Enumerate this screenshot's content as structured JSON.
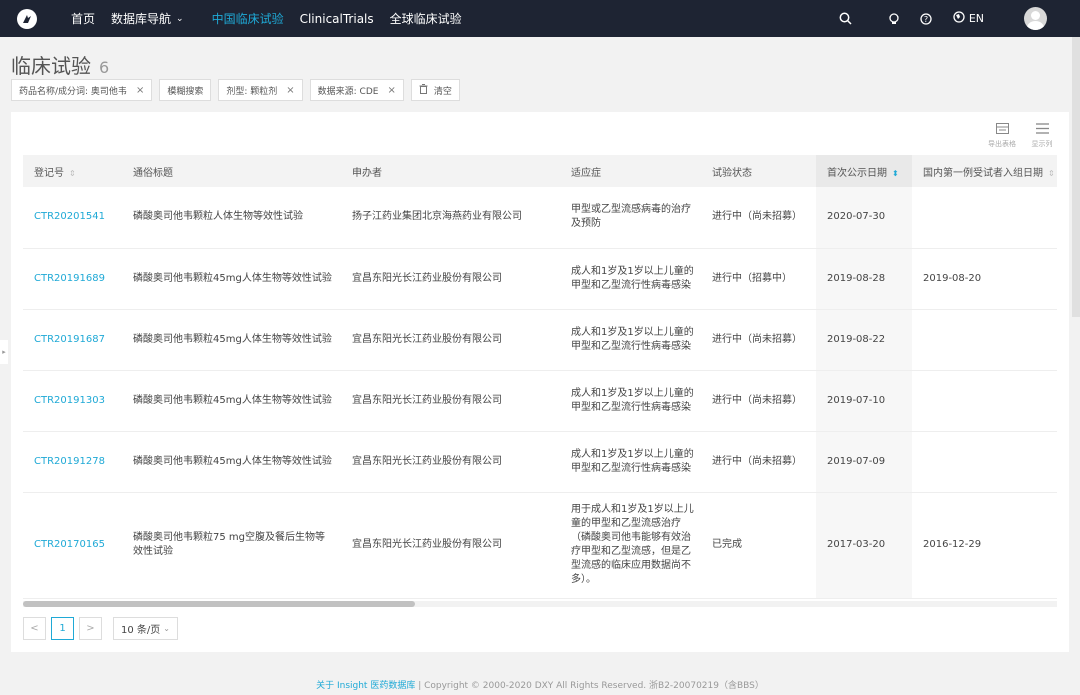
{
  "nav": {
    "home": "首页",
    "db_nav": "数据库导航",
    "china_trials": "中国临床试验",
    "clinicaltrials": "ClinicalTrials",
    "global_trials": "全球临床试验",
    "lang": "EN"
  },
  "page": {
    "title": "临床试验",
    "count": "6"
  },
  "filters": [
    {
      "label": "药品名称/成分词: 奥司他韦",
      "removable": true
    },
    {
      "label": "模糊搜索",
      "removable": false
    },
    {
      "label": "剂型: 颗粒剂",
      "removable": true
    },
    {
      "label": "数据来源: CDE",
      "removable": true
    }
  ],
  "clear_label": "清空",
  "tools": {
    "export": "导出表格",
    "columns": "显示列"
  },
  "table": {
    "headers": [
      "登记号",
      "通俗标题",
      "申办者",
      "适应症",
      "试验状态",
      "首次公示日期",
      "国内第一例受试者入组日期"
    ],
    "rows": [
      {
        "id": "CTR20201541",
        "title": "磷酸奥司他韦颗粒人体生物等效性试验",
        "sponsor": "扬子江药业集团北京海燕药业有限公司",
        "indication": "甲型或乙型流感病毒的治疗及预防",
        "status": "进行中（尚未招募）",
        "pub_date": "2020-07-30",
        "first_date": ""
      },
      {
        "id": "CTR20191689",
        "title": "磷酸奥司他韦颗粒45mg人体生物等效性试验",
        "sponsor": "宜昌东阳光长江药业股份有限公司",
        "indication": "成人和1岁及1岁以上儿童的甲型和乙型流行性病毒感染",
        "status": "进行中（招募中）",
        "pub_date": "2019-08-28",
        "first_date": "2019-08-20"
      },
      {
        "id": "CTR20191687",
        "title": "磷酸奥司他韦颗粒45mg人体生物等效性试验",
        "sponsor": "宜昌东阳光长江药业股份有限公司",
        "indication": "成人和1岁及1岁以上儿童的甲型和乙型流行性病毒感染",
        "status": "进行中（尚未招募）",
        "pub_date": "2019-08-22",
        "first_date": ""
      },
      {
        "id": "CTR20191303",
        "title": "磷酸奥司他韦颗粒45mg人体生物等效性试验",
        "sponsor": "宜昌东阳光长江药业股份有限公司",
        "indication": "成人和1岁及1岁以上儿童的甲型和乙型流行性病毒感染",
        "status": "进行中（尚未招募）",
        "pub_date": "2019-07-10",
        "first_date": ""
      },
      {
        "id": "CTR20191278",
        "title": "磷酸奥司他韦颗粒45mg人体生物等效性试验",
        "sponsor": "宜昌东阳光长江药业股份有限公司",
        "indication": "成人和1岁及1岁以上儿童的甲型和乙型流行性病毒感染",
        "status": "进行中（尚未招募）",
        "pub_date": "2019-07-09",
        "first_date": ""
      },
      {
        "id": "CTR20170165",
        "title": "磷酸奥司他韦颗粒75 mg空腹及餐后生物等效性试验",
        "sponsor": "宜昌东阳光长江药业股份有限公司",
        "indication": "用于成人和1岁及1岁以上儿童的甲型和乙型流感治疗（磷酸奥司他韦能够有效治疗甲型和乙型流感，但是乙型流感的临床应用数据尚不多）。",
        "status": "已完成",
        "pub_date": "2017-03-20",
        "first_date": "2016-12-29"
      }
    ]
  },
  "pager": {
    "prev": "<",
    "current": "1",
    "next": ">",
    "page_size": "10 条/页"
  },
  "footer": {
    "link": "关于 Insight 医药数据库",
    "copyright": " | Copyright © 2000-2020 DXY All Rights Reserved. 浙B2-20070219（含BBS）"
  },
  "colors": {
    "nav_bg": "#1e2433",
    "accent": "#1fa9d6"
  },
  "icons": [
    "logo-icon",
    "search-icon",
    "lightbulb-icon",
    "help-icon",
    "globe-icon",
    "trash-icon",
    "export-icon",
    "columns-icon",
    "close-icon",
    "sort-icon"
  ]
}
